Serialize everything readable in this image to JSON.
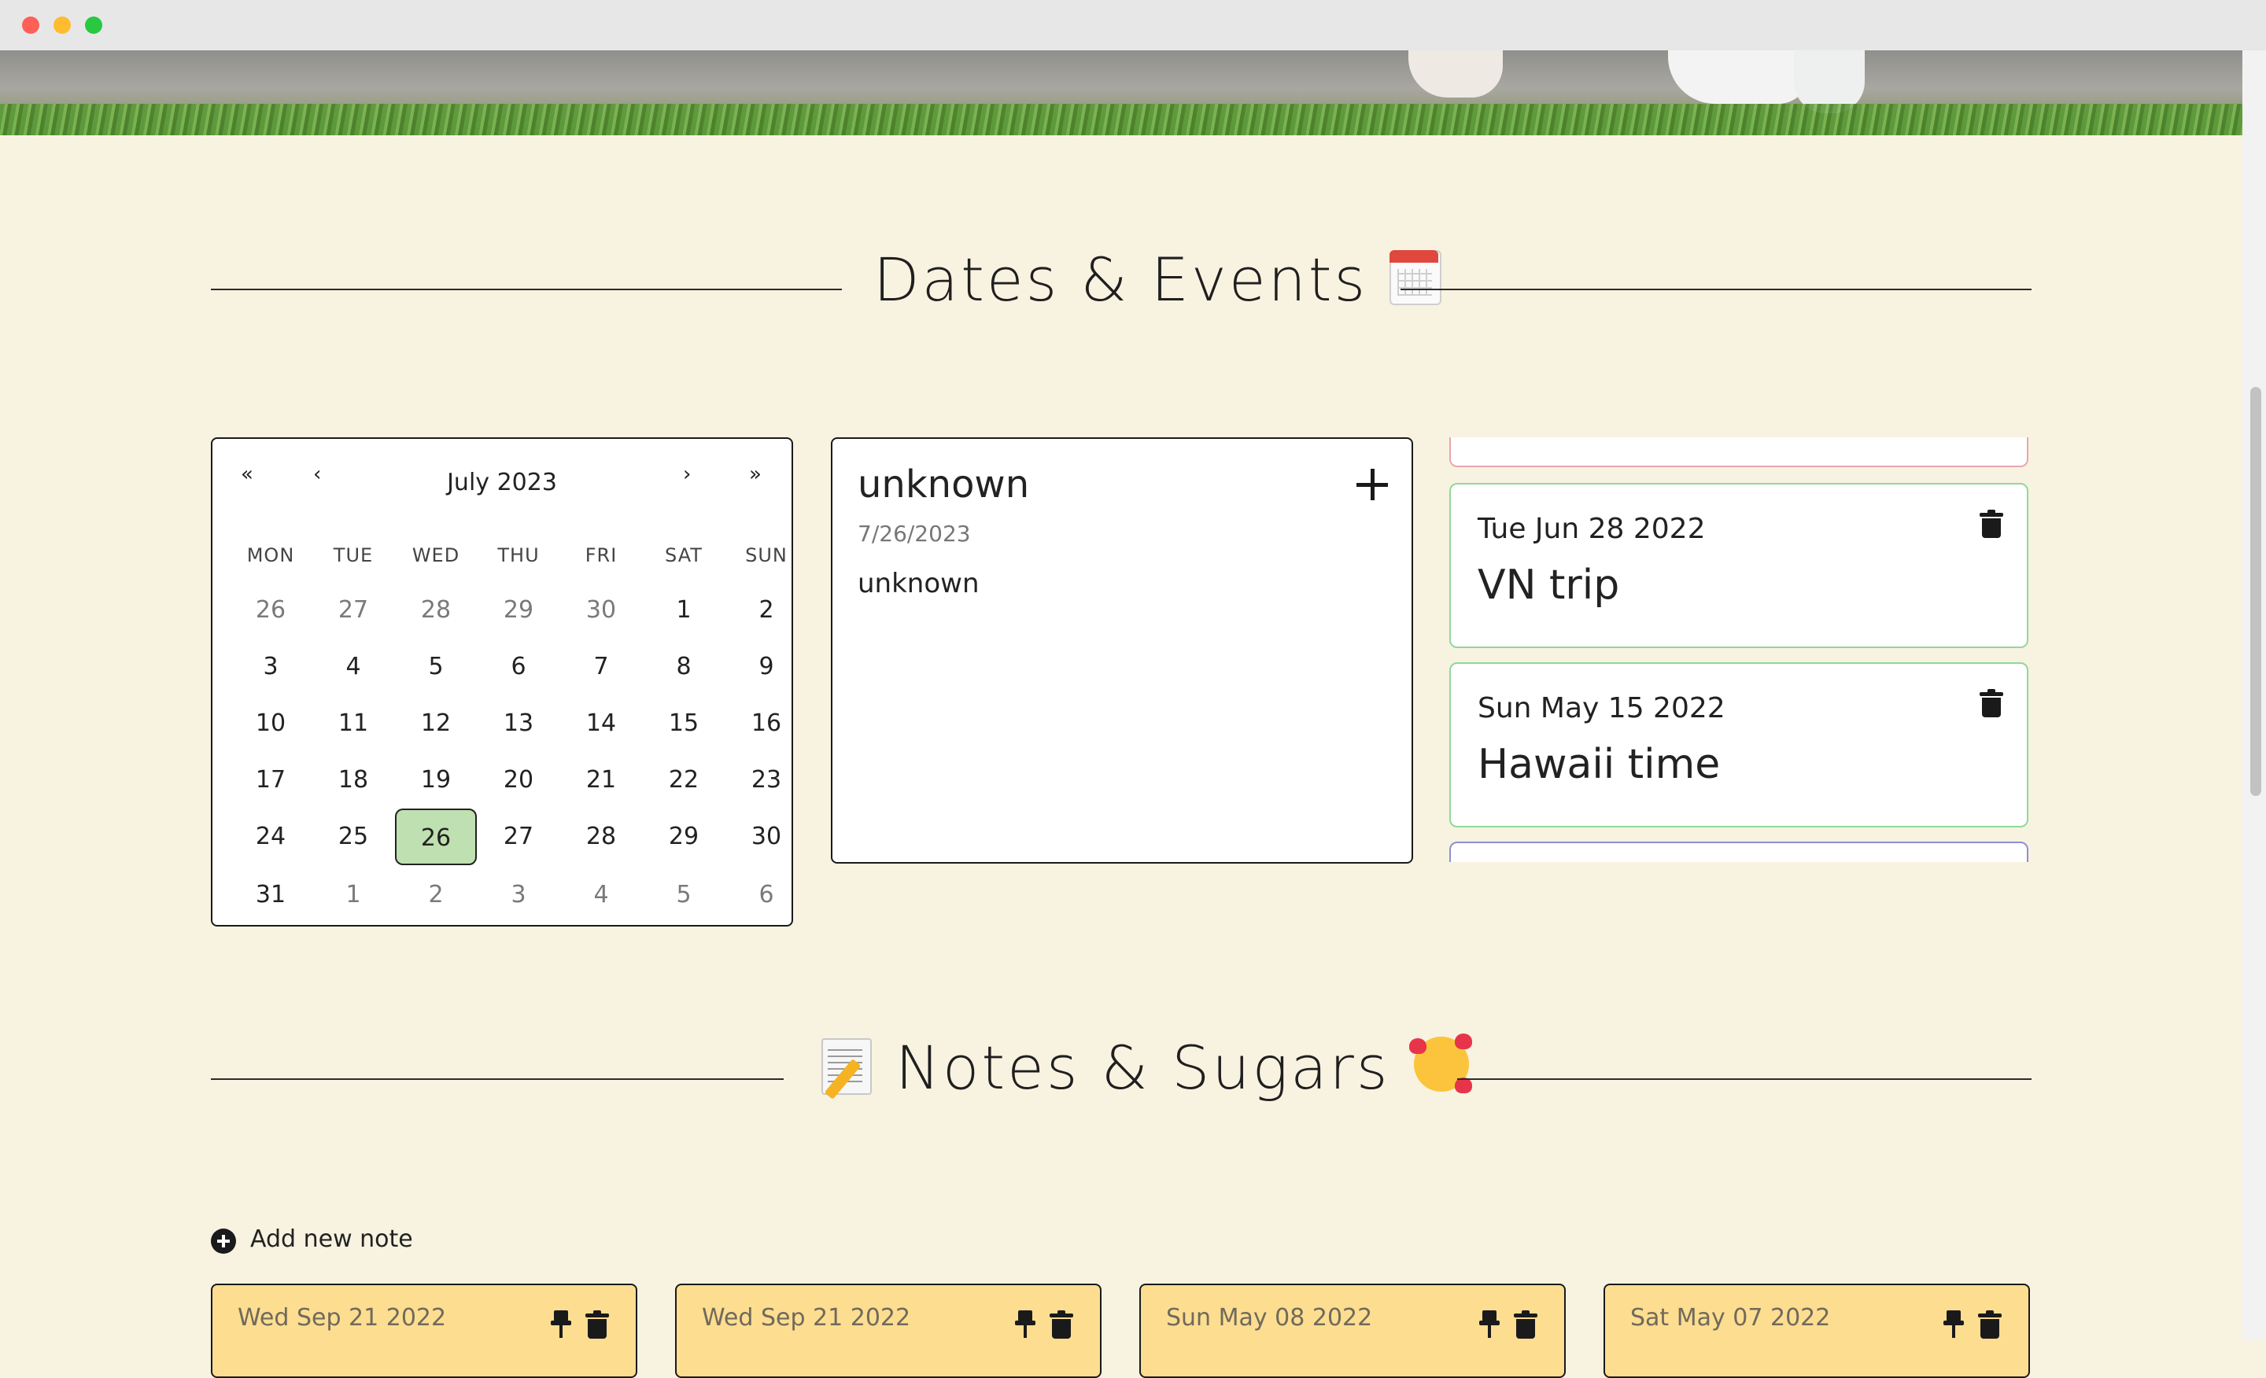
{
  "window": {
    "title": ""
  },
  "dates_section": {
    "title": "Dates & Events",
    "emoji": "calendar-emoji"
  },
  "calendar": {
    "prev_year": "«",
    "prev_month": "‹",
    "month_label": "July 2023",
    "next_month": "›",
    "next_year": "»",
    "weekdays": [
      "MON",
      "TUE",
      "WED",
      "THU",
      "FRI",
      "SAT",
      "SUN"
    ],
    "weeks": [
      [
        "26",
        "27",
        "28",
        "29",
        "30",
        "1",
        "2"
      ],
      [
        "3",
        "4",
        "5",
        "6",
        "7",
        "8",
        "9"
      ],
      [
        "10",
        "11",
        "12",
        "13",
        "14",
        "15",
        "16"
      ],
      [
        "17",
        "18",
        "19",
        "20",
        "21",
        "22",
        "23"
      ],
      [
        "24",
        "25",
        "26",
        "27",
        "28",
        "29",
        "30"
      ],
      [
        "31",
        "1",
        "2",
        "3",
        "4",
        "5",
        "6"
      ]
    ],
    "selected_day": "26"
  },
  "event_detail": {
    "title": "unknown",
    "date": "7/26/2023",
    "description": "unknown",
    "add_icon": "plus-icon"
  },
  "events": [
    {
      "date": "Tue Jun 28 2022",
      "title": "VN trip",
      "border_color": "#8fd99a"
    },
    {
      "date": "Sun May 15 2022",
      "title": "Hawaii time",
      "border_color": "#8fd99a"
    }
  ],
  "event_partial_colors": {
    "top": "#e8a7b0",
    "bottom": "#8d8fd9"
  },
  "notes_section": {
    "title": "Notes & Sugars",
    "emoji_left": "memo-emoji",
    "emoji_right": "smiling-face-with-hearts-emoji"
  },
  "add_note": {
    "label": "Add new note"
  },
  "notes": [
    {
      "date": "Wed Sep 21 2022"
    },
    {
      "date": "Wed Sep 21 2022"
    },
    {
      "date": "Sun May 08 2022"
    },
    {
      "date": "Sat May 07 2022"
    }
  ],
  "colors": {
    "background": "#f8f2e0",
    "note": "#fddd90",
    "selected_day": "#bfe0b0",
    "event_border": "#8fd99a"
  }
}
